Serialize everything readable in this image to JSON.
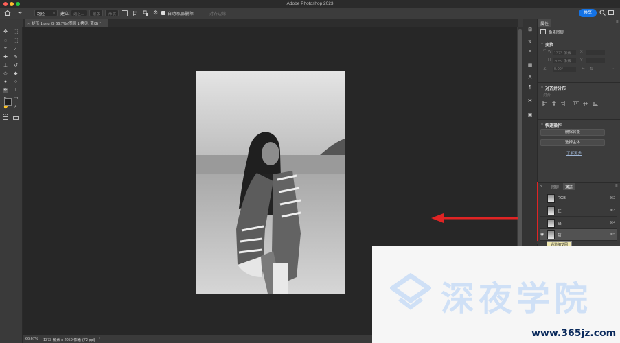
{
  "app": {
    "title": "Adobe Photoshop 2023"
  },
  "options_bar": {
    "path_label": "路径",
    "make_label": "建立:",
    "selection_btn": "选区...",
    "mask_btn": "蒙版",
    "shape_btn": "形状",
    "auto_add_delete": "自动添加/删除",
    "align_edges": "对齐边缘",
    "share_label": "共享"
  },
  "document": {
    "tab_title": "矩形 1.png @ 66.7% (图层 1 拷贝, 蓝/8) *"
  },
  "status": {
    "zoom": "66.67%",
    "doc_info": "1373 像素 x 2059 像素 (72 ppi)"
  },
  "properties": {
    "tab_label": "属性",
    "layer_type": "像素图层",
    "transform_title": "变换",
    "w_label": "W",
    "w_value": "1373 像素",
    "h_label": "H",
    "h_value": "2059 像素",
    "x_label": "X",
    "y_label": "Y",
    "angle_value": "0.00°",
    "align_title": "对齐并分布",
    "align_label": "对齐:",
    "quick_actions_title": "快速操作",
    "remove_bg": "删除背景",
    "select_subject": "选择主体",
    "learn_more": "了解更多"
  },
  "channels_panel": {
    "tabs": [
      "3D",
      "图层",
      "通道"
    ],
    "active_tab": "通道",
    "rows": [
      {
        "name": "RGB",
        "shortcut": "⌘2"
      },
      {
        "name": "红",
        "shortcut": "⌘3"
      },
      {
        "name": "绿",
        "shortcut": "⌘4"
      },
      {
        "name": "蓝",
        "shortcut": "⌘5"
      }
    ],
    "tooltip": "通道缩览图"
  },
  "watermark": {
    "text": "深夜学院",
    "url": "www.365jz.com"
  },
  "colors": {
    "accent": "#1473e6",
    "highlight_red": "#e02424",
    "arrow_red": "#e02424"
  }
}
